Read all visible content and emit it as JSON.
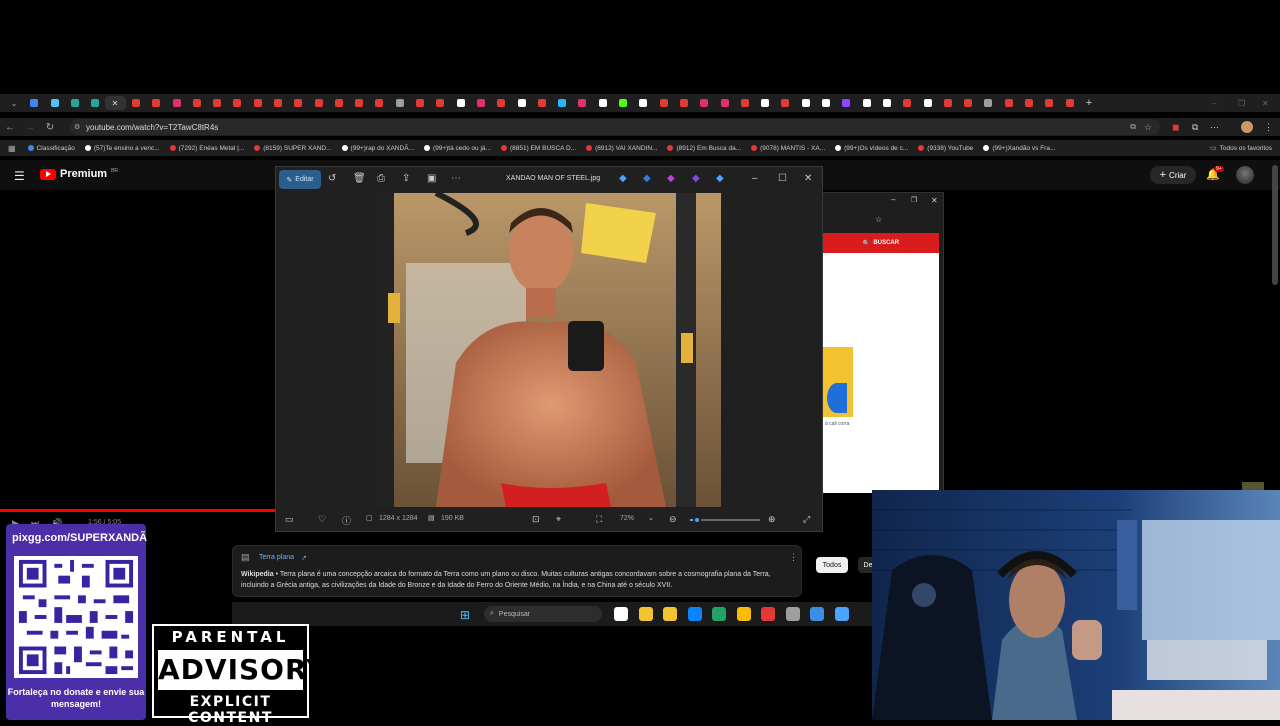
{
  "browser": {
    "url": "youtube.com/watch?v=T2TawC8tR4s",
    "tab_favicon_colors": [
      "#4285f4",
      "#4fc3f7",
      "#26a69a",
      "#26a69a",
      "#ffffff",
      "#e53935",
      "#e53935",
      "#e1306c",
      "#e53935",
      "#e53935",
      "#e53935",
      "#e53935",
      "#e53935",
      "#e53935",
      "#e53935",
      "#e53935",
      "#e53935",
      "#e53935",
      "#9e9e9e",
      "#e53935",
      "#e53935",
      "#ffffff",
      "#e1306c",
      "#e53935",
      "#ffffff",
      "#e53935",
      "#29b6f6",
      "#e1306c",
      "#ffffff",
      "#53fc18",
      "#ffffff",
      "#e53935",
      "#e53935",
      "#e1306c",
      "#e1306c",
      "#e53935",
      "#ffffff",
      "#e53935",
      "#ffffff",
      "#ffffff",
      "#9146ff",
      "#ffffff",
      "#ffffff",
      "#e53935",
      "#ffffff",
      "#e53935",
      "#e53935",
      "#9e9e9e",
      "#e53935",
      "#e53935",
      "#e53935",
      "#e53935"
    ],
    "new_tab_icon": "plus-icon",
    "bookmarks": [
      {
        "label": "Classificação",
        "color": "#4285f4"
      },
      {
        "label": "(57)Te ensino a venc...",
        "color": "#ffffff"
      },
      {
        "label": "(7292) Enéas Metal |...",
        "color": "#e53935"
      },
      {
        "label": "(8159) SUPER XAND...",
        "color": "#e53935"
      },
      {
        "label": "(99+)rap do XANDÃ...",
        "color": "#ffffff"
      },
      {
        "label": "(99+)tá cedo ou já...",
        "color": "#ffffff"
      },
      {
        "label": "(8851) EM BUSCA D...",
        "color": "#e53935"
      },
      {
        "label": "(8912) VAI XANDIN...",
        "color": "#e53935"
      },
      {
        "label": "(8912) Em Busca da...",
        "color": "#e53935"
      },
      {
        "label": "(9078) MANTIS - XA...",
        "color": "#e53935"
      },
      {
        "label": "(99+)Os vídeos de c...",
        "color": "#ffffff"
      },
      {
        "label": "(9338) YouTube",
        "color": "#e53935"
      },
      {
        "label": "(99+)Xandão vs Fra...",
        "color": "#ffffff"
      }
    ],
    "all_bookmarks": "Todos os favoritos"
  },
  "youtube": {
    "brand": "Premium",
    "country": "BR",
    "create_label": "Criar",
    "notif_count": "9+",
    "time": "1:56 / 5:05"
  },
  "viewer": {
    "edit_label": "Editar",
    "filename": "XANDAO MAN OF STEEL.jpg",
    "dimensions": "1284 x 1284",
    "size": "190 KB",
    "zoom": "72%",
    "zoom_fraction": 0.1
  },
  "bg_browser": {
    "search_label": "BUSCAR",
    "small_text": "à cali corra"
  },
  "wiki": {
    "title": "Terra plana",
    "source": "Wikipedia",
    "text": "• Terra plana é uma concepção arcaica do formato da Terra como um plano ou disco. Muitas culturas antigas concordavam sobre a cosmografia plana da Terra, incluindo a Grécia antiga, as civilizações da Idade do Bronze e da Idade do Ferro do Oriente Médio, na Índia, e na China até o século XVII."
  },
  "chips": {
    "todos": "Todos",
    "de": "De"
  },
  "taskbar": {
    "search_placeholder": "Pesquisar",
    "app_colors": [
      "#ffffff",
      "#f4c430",
      "#f4c430",
      "#0a84ff",
      "#21a366",
      "#fbbc05",
      "#e53935",
      "#9e9e9e",
      "#3a8ee6",
      "#4aa3ff"
    ]
  },
  "overlay": {
    "pix_url": "pixgg.com/SUPERXANDÃ",
    "donate_msg": "Fortaleça no donate e envie sua mensagem!",
    "pa_top": "PARENTAL",
    "pa_mid": "ADVISORY",
    "pa_bot": "EXPLICIT CONTENT"
  },
  "colors": {
    "youtube_red": "#ff0000",
    "qr_panel": "#4b2fa8",
    "accent_blue": "#4aa3ff"
  }
}
